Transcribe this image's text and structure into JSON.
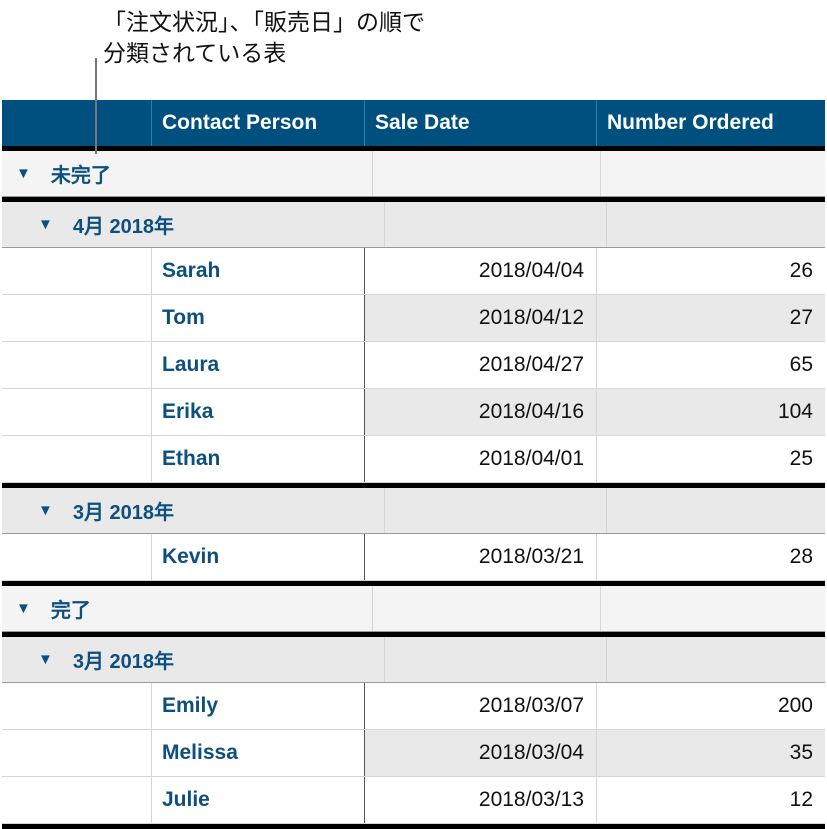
{
  "caption": {
    "line1": "「注文状況」、「販売日」の順で",
    "line2": "分類されている表"
  },
  "table": {
    "headers": [
      "",
      "Contact Person",
      "Sale Date",
      "Number Ordered"
    ],
    "colors": {
      "header_bg": "#00507f",
      "accent_text": "#0d4f7e"
    },
    "groups": [
      {
        "label": "未完了",
        "subgroups": [
          {
            "label": "4月 2018年",
            "rows": [
              {
                "person": "Sarah",
                "date": "2018/04/04",
                "number": "26"
              },
              {
                "person": "Tom",
                "date": "2018/04/12",
                "number": "27"
              },
              {
                "person": "Laura",
                "date": "2018/04/27",
                "number": "65"
              },
              {
                "person": "Erika",
                "date": "2018/04/16",
                "number": "104"
              },
              {
                "person": "Ethan",
                "date": "2018/04/01",
                "number": "25"
              }
            ]
          },
          {
            "label": "3月 2018年",
            "rows": [
              {
                "person": "Kevin",
                "date": "2018/03/21",
                "number": "28"
              }
            ]
          }
        ]
      },
      {
        "label": "完了",
        "subgroups": [
          {
            "label": "3月 2018年",
            "rows": [
              {
                "person": "Emily",
                "date": "2018/03/07",
                "number": "200"
              },
              {
                "person": "Melissa",
                "date": "2018/03/04",
                "number": "35"
              },
              {
                "person": "Julie",
                "date": "2018/03/13",
                "number": "12"
              }
            ]
          }
        ]
      }
    ],
    "toggle_glyph": "▼"
  }
}
